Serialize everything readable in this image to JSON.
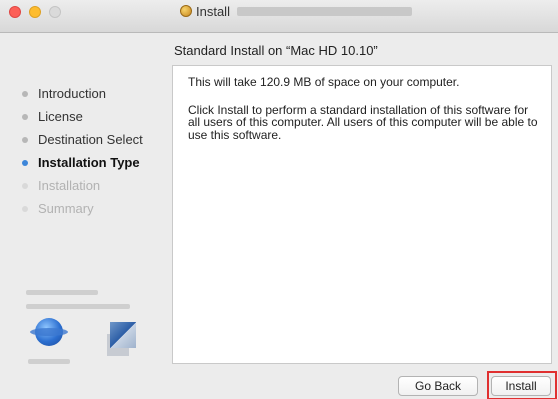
{
  "window": {
    "title_prefix": "Install",
    "controls": [
      "close",
      "minimize",
      "zoom"
    ]
  },
  "heading": "Standard Install on “Mac HD 10.10”",
  "sidebar": {
    "steps": [
      {
        "label": "Introduction",
        "state": "done"
      },
      {
        "label": "License",
        "state": "done"
      },
      {
        "label": "Destination Select",
        "state": "done"
      },
      {
        "label": "Installation Type",
        "state": "current"
      },
      {
        "label": "Installation",
        "state": "pending"
      },
      {
        "label": "Summary",
        "state": "pending"
      }
    ]
  },
  "content": {
    "line1": "This will take 120.9 MB of space on your computer.",
    "line2": "Click Install to perform a standard installation of this software for all users of this computer. All users of this computer will be able to use this software."
  },
  "buttons": {
    "go_back": "Go Back",
    "install": "Install"
  },
  "colors": {
    "current_step_bullet": "#3d86d9",
    "highlight": "#e03030"
  },
  "icons": [
    "installer-package-icon",
    "globe-logo-icon",
    "blue-box-logo-icon"
  ]
}
